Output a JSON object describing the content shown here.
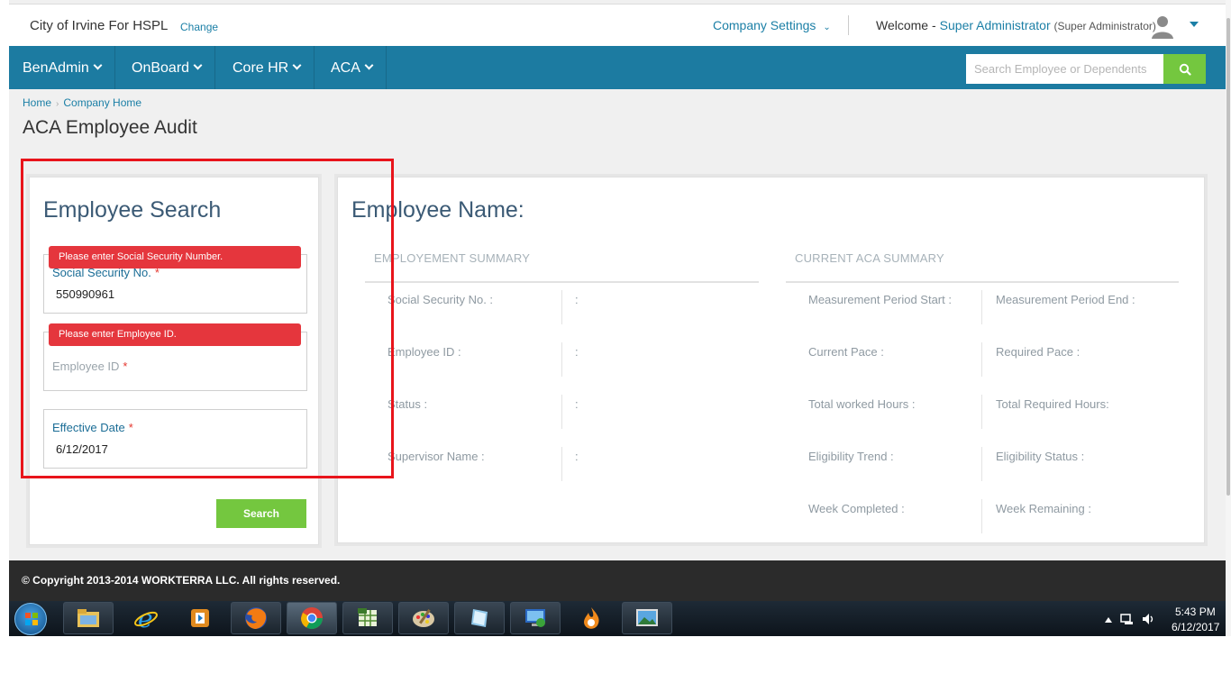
{
  "header": {
    "company_name": "City of Irvine For HSPL",
    "change_label": "Change",
    "company_settings_label": "Company Settings",
    "welcome_prefix": "Welcome -",
    "user_name": "Super Administrator",
    "user_role": "(Super Administrator)"
  },
  "nav": {
    "items": [
      {
        "label": "BenAdmin"
      },
      {
        "label": "OnBoard"
      },
      {
        "label": "Core HR"
      },
      {
        "label": "ACA"
      }
    ],
    "search_placeholder": "Search Employee or Dependents"
  },
  "breadcrumb": {
    "home": "Home",
    "current": "Company Home"
  },
  "page_title": "ACA Employee Audit",
  "employee_search": {
    "title": "Employee Search",
    "ssn": {
      "label": "Social Security No.",
      "value": "550990961",
      "error": "Please enter Social Security Number."
    },
    "employee_id": {
      "label": "Employee ID",
      "value": "",
      "error": "Please enter Employee ID."
    },
    "effective_date": {
      "label": "Effective Date",
      "value": "6/12/2017"
    },
    "required_mark": "*",
    "search_button": "Search"
  },
  "employee_panel": {
    "title": "Employee Name:",
    "employment_summary": {
      "heading": "EMPLOYEMENT SUMMARY",
      "rows": [
        {
          "label": "Social Security No. :",
          "value": ":"
        },
        {
          "label": "Employee ID :",
          "value": ":"
        },
        {
          "label": "Status :",
          "value": ":"
        },
        {
          "label": "Supervisor Name :",
          "value": ":"
        }
      ]
    },
    "aca_summary": {
      "heading": "CURRENT ACA SUMMARY",
      "rows": [
        {
          "left": "Measurement Period Start :",
          "right": "Measurement Period End :"
        },
        {
          "left": "Current Pace :",
          "right": "Required Pace :"
        },
        {
          "left": "Total worked Hours :",
          "right": "Total Required Hours:"
        },
        {
          "left": "Eligibility Trend :",
          "right": "Eligibility Status :"
        },
        {
          "left": "Week Completed :",
          "right": "Week Remaining :"
        }
      ]
    }
  },
  "footer": {
    "copyright": "© Copyright 2013-2014 WORKTERRA LLC. All rights reserved."
  },
  "taskbar": {
    "apps": [
      "file-explorer-icon",
      "internet-explorer-icon",
      "media-player-icon",
      "firefox-icon",
      "chrome-icon",
      "spreadsheet-icon",
      "paint-icon",
      "notepad-icon",
      "remote-desktop-icon",
      "blender-icon",
      "photo-viewer-icon"
    ],
    "time": "5:43 PM",
    "date": "6/12/2017"
  },
  "colors": {
    "nav_blue": "#1c7ba1",
    "accent_green": "#74c73f",
    "error_red": "#e5363d",
    "annotation_red": "#e8141b"
  }
}
